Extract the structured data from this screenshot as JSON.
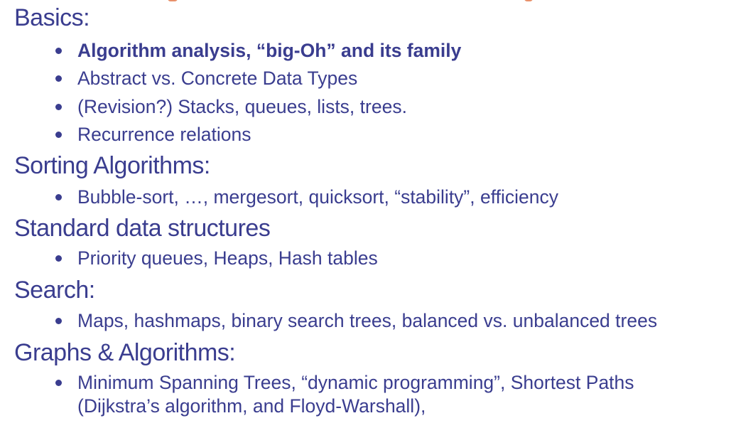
{
  "sections": [
    {
      "heading": "Basics:",
      "items": [
        {
          "text": "Algorithm analysis, “big-Oh” and its family",
          "bold": true
        },
        {
          "text": "Abstract vs. Concrete Data Types"
        },
        {
          "text": "(Revision?) Stacks, queues, lists, trees."
        },
        {
          "text": "Recurrence relations"
        }
      ]
    },
    {
      "heading": "Sorting Algorithms:",
      "items": [
        {
          "text": "Bubble-sort, …, mergesort, quicksort, “stability”, efficiency"
        }
      ]
    },
    {
      "heading": "Standard data structures",
      "items": [
        {
          "text": "Priority queues, Heaps, Hash tables"
        }
      ]
    },
    {
      "heading": "Search:",
      "items": [
        {
          "text": "Maps, hashmaps, binary search trees, balanced vs. unbalanced trees"
        }
      ]
    },
    {
      "heading": "Graphs & Algorithms:",
      "items": [
        {
          "text": "Minimum Spanning Trees, “dynamic programming”, Shortest Paths",
          "continuation": "(Dijkstra’s algorithm, and Floyd-Warshall),"
        }
      ]
    }
  ]
}
